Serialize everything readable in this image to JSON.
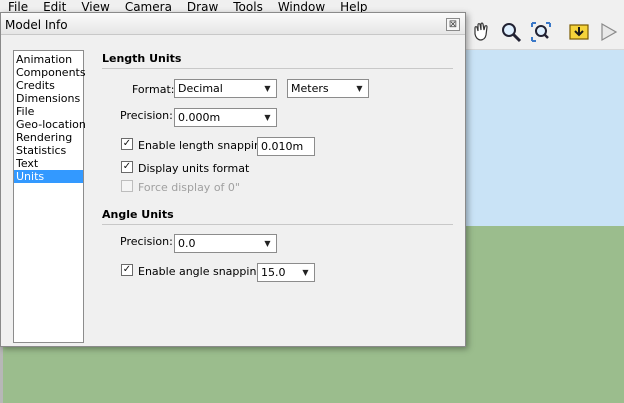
{
  "menu": [
    "File",
    "Edit",
    "View",
    "Camera",
    "Draw",
    "Tools",
    "Window",
    "Help"
  ],
  "toolbar": {
    "icons": [
      "pan-icon",
      "zoom-icon",
      "zoom-extents-icon",
      "warehouse-icon",
      "send-to-layout-icon"
    ]
  },
  "colors": {
    "sky": "#c9e3f6",
    "ground": "#9bbd8d",
    "selection": "#3399ff"
  },
  "dialog": {
    "title": "Model Info",
    "close_glyph": "⊠",
    "categories": [
      "Animation",
      "Components",
      "Credits",
      "Dimensions",
      "File",
      "Geo-location",
      "Rendering",
      "Statistics",
      "Text",
      "Units"
    ],
    "selected_category": "Units",
    "length": {
      "heading": "Length Units",
      "format_label": "Format:",
      "format_value": "Decimal",
      "unit_value": "Meters",
      "precision_label": "Precision:",
      "precision_value": "0.000m",
      "snapping_label": "Enable length snapping",
      "snapping_checked": true,
      "snapping_value": "0.010m",
      "display_units_label": "Display units format",
      "display_units_checked": true,
      "force_display_label": "Force display of 0\"",
      "force_display_checked": false
    },
    "angle": {
      "heading": "Angle Units",
      "precision_label": "Precision:",
      "precision_value": "0.0",
      "snapping_label": "Enable angle snapping",
      "snapping_checked": true,
      "snapping_value": "15.0"
    }
  }
}
